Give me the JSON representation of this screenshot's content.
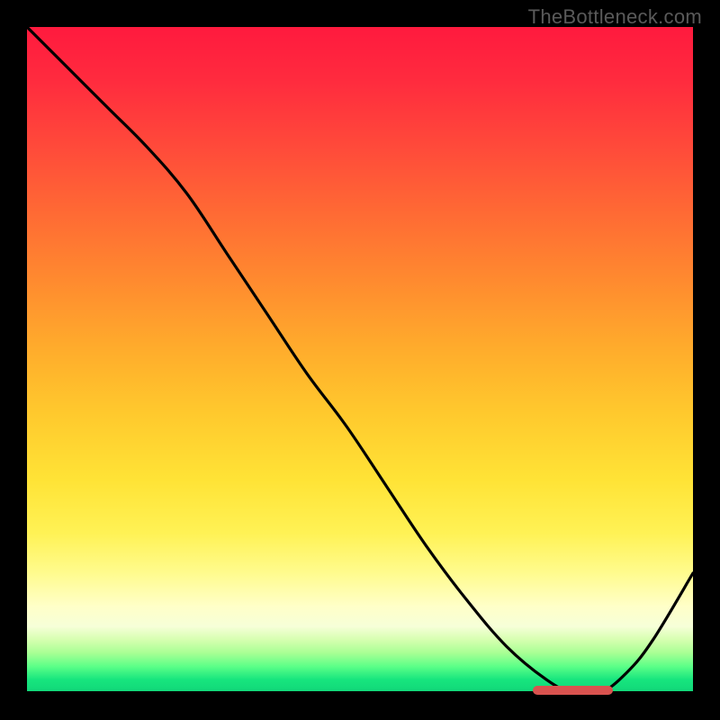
{
  "watermark": "TheBottleneck.com",
  "colors": {
    "gradient_top": "#ff1a3e",
    "gradient_mid": "#ffe336",
    "gradient_bottom": "#10d678",
    "curve": "#000000",
    "marker": "#d9534f",
    "background": "#000000",
    "watermark": "#5a5a5a"
  },
  "chart_data": {
    "type": "line",
    "title": "",
    "xlabel": "",
    "ylabel": "",
    "xlim": [
      0,
      100
    ],
    "ylim": [
      0,
      100
    ],
    "grid": false,
    "legend": false,
    "series": [
      {
        "name": "bottleneck-curve",
        "x": [
          0,
          6,
          12,
          18,
          24,
          30,
          36,
          42,
          48,
          54,
          60,
          66,
          72,
          78,
          82,
          86,
          90,
          94,
          100
        ],
        "y": [
          100,
          94,
          88,
          82,
          75,
          66,
          57,
          48,
          40,
          31,
          22,
          14,
          7,
          2,
          0,
          0,
          3,
          8,
          18
        ]
      }
    ],
    "marker": {
      "x_start": 76,
      "x_end": 88,
      "y": 0,
      "label": ""
    },
    "background_gradient": {
      "orientation": "vertical",
      "stops": [
        {
          "pos": 0.0,
          "color": "#ff1a3e"
        },
        {
          "pos": 0.5,
          "color": "#ffc92d"
        },
        {
          "pos": 0.8,
          "color": "#fffb8e"
        },
        {
          "pos": 1.0,
          "color": "#10d678"
        }
      ]
    }
  }
}
